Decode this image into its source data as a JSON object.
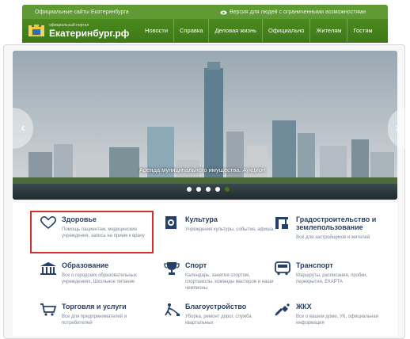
{
  "topbar": {
    "official_sites": "Официальные сайты Екатеринбурга",
    "accessibility_version": "Версия для людей с ограниченными возможностями"
  },
  "header": {
    "logo_subtitle": "официальный портал",
    "logo_title": "Екатеринбург.рф",
    "nav": [
      "Новости",
      "Справка",
      "Деловая жизнь",
      "Официально",
      "Жителям",
      "Гостям"
    ]
  },
  "slider": {
    "caption": "Аренда муниципального имущества. Аукцион",
    "dot_count": 5,
    "active_dot": 5
  },
  "categories": [
    {
      "icon": "heart-icon",
      "title": "Здоровье",
      "desc": "Помощь пациентам, медицинские учреждения, запись на прием к врачу"
    },
    {
      "icon": "culture-icon",
      "title": "Культура",
      "desc": "Учреждения культуры, события, афиша"
    },
    {
      "icon": "construction-icon",
      "title": "Градостроительство и землепользование",
      "desc": "Всё для застройщиков и жителей"
    },
    {
      "icon": "education-icon",
      "title": "Образование",
      "desc": "Все о городских образовательных учреждениях, Школьное питание"
    },
    {
      "icon": "trophy-icon",
      "title": "Спорт",
      "desc": "Календарь, занятия спортом, спортшколы, команды мастеров и наши чемпионы"
    },
    {
      "icon": "bus-icon",
      "title": "Транспорт",
      "desc": "Маршруты, расписания, пробки, перекрытия, ЕКАРТА"
    },
    {
      "icon": "cart-icon",
      "title": "Торговля и услуги",
      "desc": "Все для предпринимателей и потребителей"
    },
    {
      "icon": "gardener-icon",
      "title": "Благоустройство",
      "desc": "Уборка, ремонт дорог, служба квартальных"
    },
    {
      "icon": "plumbing-icon",
      "title": "ЖКХ",
      "desc": "Все о вашем доме, УК, официальная информация"
    }
  ],
  "colors": {
    "brand_green": "#4b8a1f",
    "title_blue": "#25406b",
    "highlight_red": "#d32f2f"
  }
}
